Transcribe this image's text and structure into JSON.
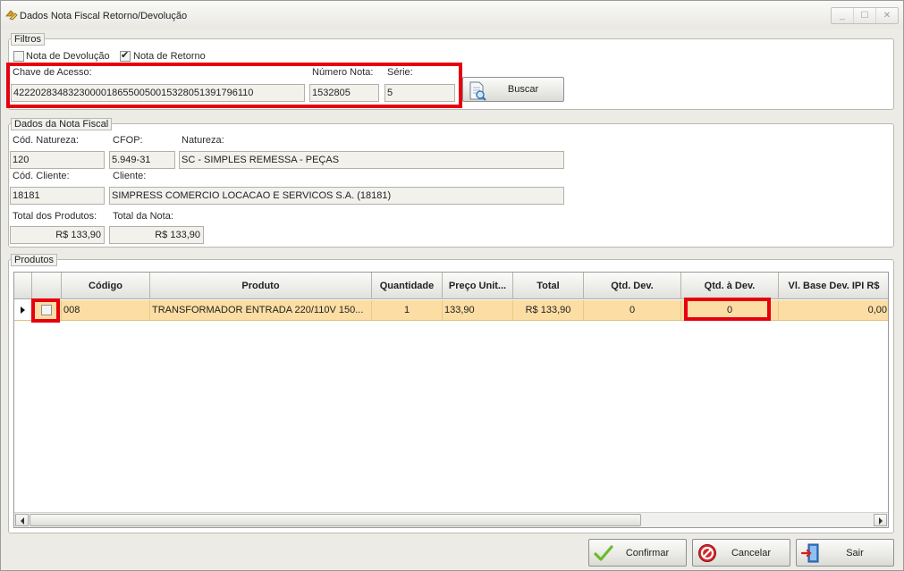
{
  "window": {
    "title": "Dados Nota Fiscal Retorno/Devolução"
  },
  "filtros": {
    "legend": "Filtros",
    "cb_devolucao_label": "Nota de Devolução",
    "cb_devolucao_checked": false,
    "cb_retorno_label": "Nota de Retorno",
    "cb_retorno_checked": true,
    "chave_label": "Chave de Acesso:",
    "chave_value": "42220283483230000186550050015328051391796110",
    "numero_label": "Número Nota:",
    "numero_value": "1532805",
    "serie_label": "Série:",
    "serie_value": "5",
    "buscar_label": "Buscar"
  },
  "dados": {
    "legend": "Dados da Nota Fiscal",
    "cod_natureza_label": "Cód. Natureza:",
    "cod_natureza_value": "120",
    "cfop_label": "CFOP:",
    "cfop_value": "5.949-31",
    "natureza_label": "Natureza:",
    "natureza_value": "SC - SIMPLES REMESSA - PEÇAS",
    "cod_cliente_label": "Cód. Cliente:",
    "cod_cliente_value": "18181",
    "cliente_label": "Cliente:",
    "cliente_value": "SIMPRESS COMERCIO LOCACAO E SERVICOS S.A. (18181)",
    "total_produtos_label": "Total dos Produtos:",
    "total_produtos_value": "R$ 133,90",
    "total_nota_label": "Total da Nota:",
    "total_nota_value": "R$ 133,90"
  },
  "produtos": {
    "legend": "Produtos",
    "columns": [
      "Código",
      "Produto",
      "Quantidade",
      "Preço Unit...",
      "Total",
      "Qtd. Dev.",
      "Qtd. à Dev.",
      "Vl. Base Dev. IPI R$"
    ],
    "rows": [
      {
        "selected": false,
        "codigo": "008",
        "produto": "TRANSFORMADOR  ENTRADA  220/110V  150...",
        "quantidade": "1",
        "preco_unit": "133,90",
        "total": "R$ 133,90",
        "qtd_dev": "0",
        "qtd_a_dev": "0",
        "vl_base_dev_ipi": "0,00"
      }
    ],
    "scroll_fraction": 0
  },
  "footer": {
    "confirmar_label": "Confirmar",
    "cancelar_label": "Cancelar",
    "sair_label": "Sair"
  },
  "colors": {
    "highlight": "#e6000f",
    "row_selected": "#fcdda3"
  },
  "icons": [
    "app-icon",
    "document-search-icon",
    "check-icon",
    "cancel-icon",
    "exit-door-icon"
  ]
}
